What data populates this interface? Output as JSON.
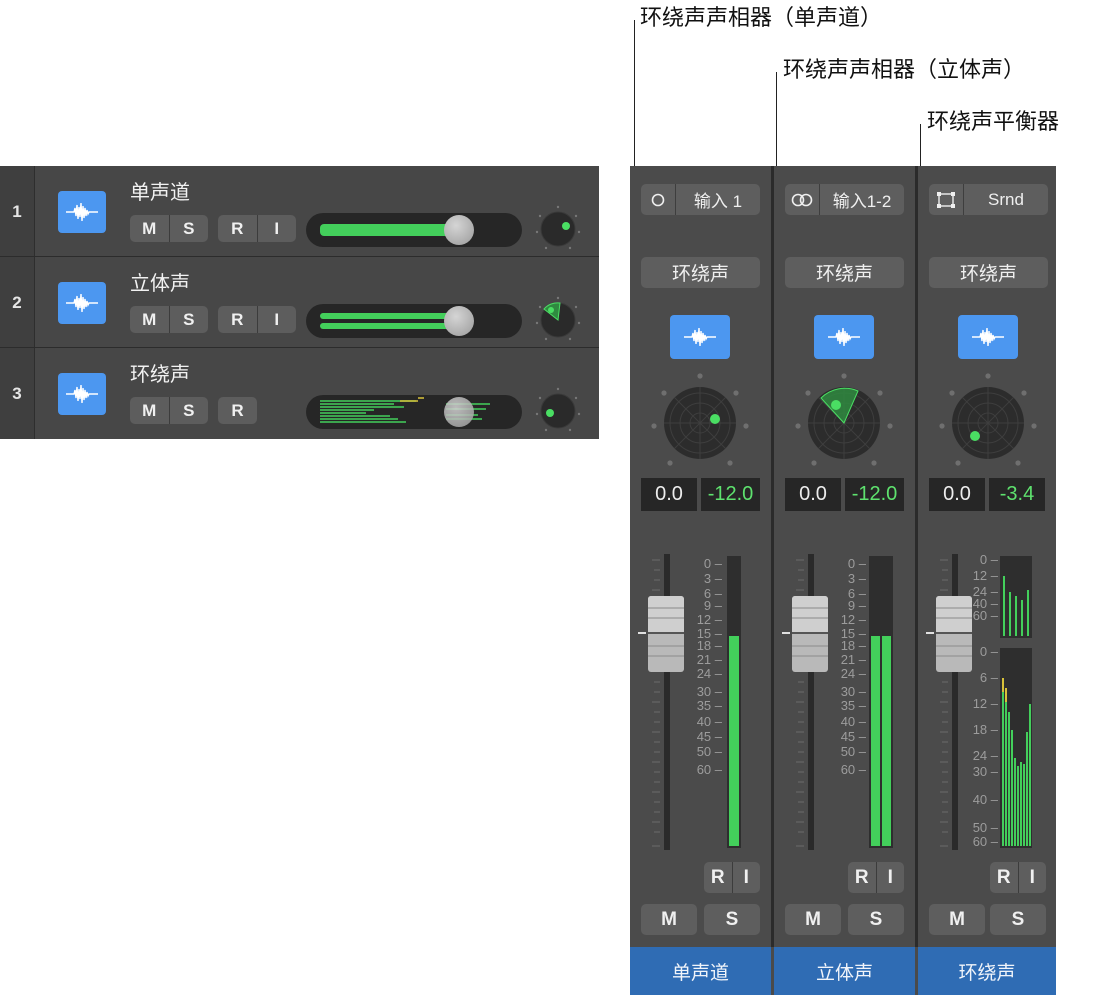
{
  "callouts": [
    {
      "text": "环绕声声相器（单声道）"
    },
    {
      "text": "环绕声声相器（立体声）"
    },
    {
      "text": "环绕声平衡器"
    }
  ],
  "tracks": [
    {
      "number": "1",
      "name": "单声道",
      "buttons": [
        "M",
        "S",
        "R",
        "I"
      ],
      "volume": 0.7
    },
    {
      "number": "2",
      "name": "立体声",
      "buttons": [
        "M",
        "S",
        "R",
        "I"
      ],
      "volume": 0.7
    },
    {
      "number": "3",
      "name": "环绕声",
      "buttons": [
        "M",
        "S",
        "R"
      ],
      "volume": 0.7
    }
  ],
  "strips": [
    {
      "input_label": "输入 1",
      "input_icon": "mono-circle-icon",
      "output_label": "环绕声",
      "pan_value": "0.0",
      "send_value": "-12.0",
      "record_label": "R",
      "input_mon_label": "I",
      "mute_label": "M",
      "solo_label": "S",
      "name": "单声道",
      "scale": [
        "0",
        "3",
        "6",
        "9",
        "12",
        "15",
        "18",
        "21",
        "24",
        "30",
        "35",
        "40",
        "45",
        "50",
        "60"
      ]
    },
    {
      "input_label": "输入1-2",
      "input_icon": "stereo-circles-icon",
      "output_label": "环绕声",
      "pan_value": "0.0",
      "send_value": "-12.0",
      "record_label": "R",
      "input_mon_label": "I",
      "mute_label": "M",
      "solo_label": "S",
      "name": "立体声",
      "scale": [
        "0",
        "3",
        "6",
        "9",
        "12",
        "15",
        "18",
        "21",
        "24",
        "30",
        "35",
        "40",
        "45",
        "50",
        "60"
      ]
    },
    {
      "input_label": "Srnd",
      "input_icon": "surround-square-icon",
      "output_label": "环绕声",
      "pan_value": "0.0",
      "send_value": "-3.4",
      "record_label": "R",
      "input_mon_label": "I",
      "mute_label": "M",
      "solo_label": "S",
      "name": "环绕声",
      "scale_top": [
        "0",
        "12",
        "24",
        "40",
        "60"
      ],
      "scale": [
        "0",
        "6",
        "12",
        "18",
        "24",
        "30",
        "40",
        "50",
        "60"
      ]
    }
  ],
  "colors": {
    "accent": "#4c97f0",
    "meter_green": "#43cf5b",
    "value_green": "#5ee26e",
    "name_bar": "#2f6cb4"
  }
}
